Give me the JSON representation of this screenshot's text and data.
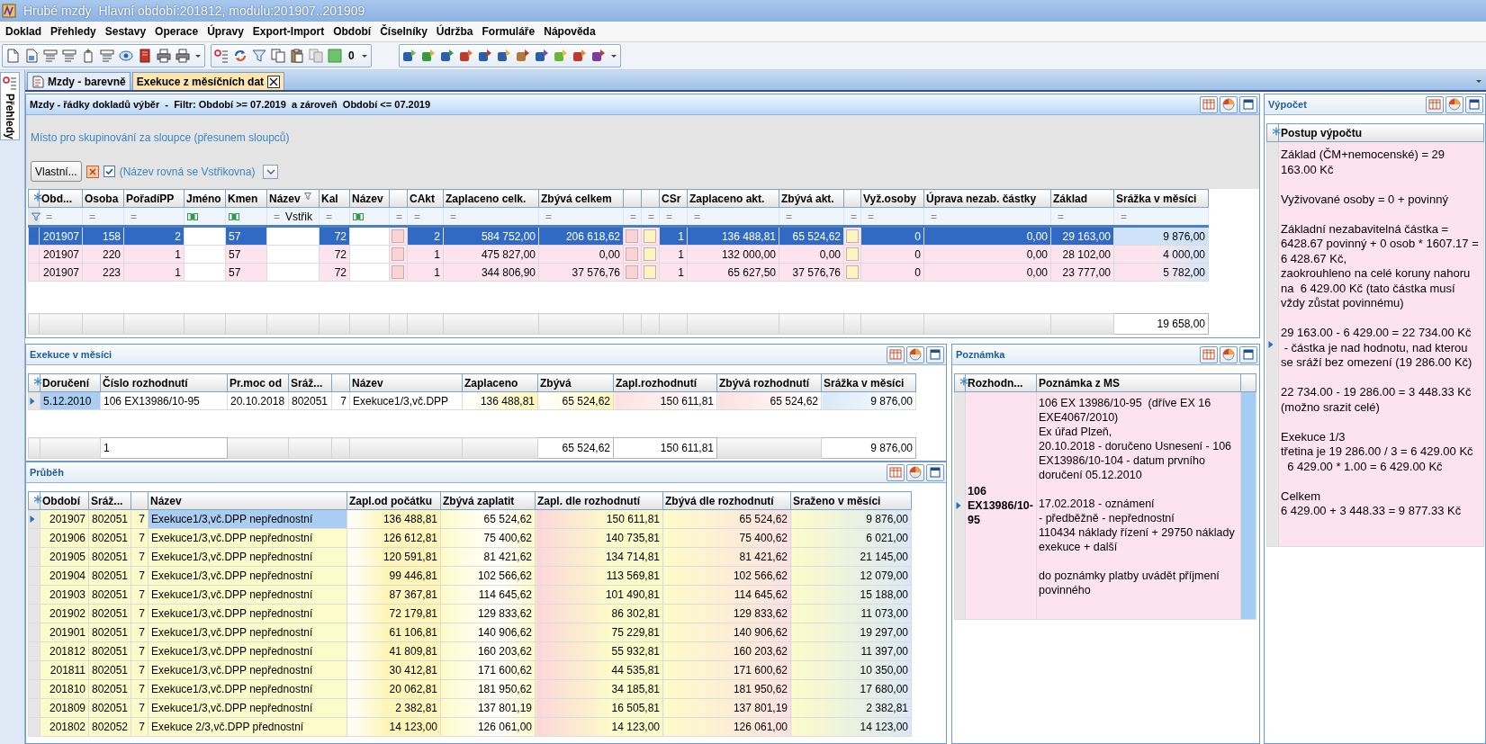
{
  "window": {
    "title": "Hrubé mzdy",
    "subtitle": "Hlavní období:201812, modulu:201907..201909"
  },
  "menu": [
    "Doklad",
    "Přehledy",
    "Sestavy",
    "Operace",
    "Úpravy",
    "Export-Import",
    "Období",
    "Číselníky",
    "Údržba",
    "Formuláře",
    "Nápověda"
  ],
  "toolbar": {
    "counter": "0"
  },
  "side_tab": {
    "label": "Přehledy"
  },
  "tabs": [
    {
      "label": "Mzdy - barevně",
      "selected": false
    },
    {
      "label": "Exekuce z měsíčních dat",
      "selected": true
    }
  ],
  "main_grid": {
    "title": "Mzdy - řádky dokladů výběr  -  Filtr: Období >= 07.2019  a zároveň  Období <= 07.2019",
    "group_hint": "Místo pro skupinování za sloupce (přesunem sloupců)",
    "filter_bar": {
      "button": "Vlastní...",
      "checked": true,
      "text": "(Název rovná se Vstřikovna)"
    },
    "columns": [
      {
        "kind": "number",
        "label": "Obd...",
        "filtered": false
      },
      {
        "kind": "number",
        "label": "Osoba",
        "filtered": false
      },
      {
        "kind": "number",
        "label": "PořadíPP",
        "filtered": false
      },
      {
        "kind": "text",
        "label": "Jméno",
        "filtered": false
      },
      {
        "kind": "text",
        "label": "Kmen",
        "filtered": false
      },
      {
        "kind": "text",
        "label": "Název",
        "filtered": true
      },
      {
        "kind": "number",
        "label": "Kal",
        "filtered": false
      },
      {
        "kind": "text",
        "label": "Název",
        "filtered": false
      },
      {
        "kind": "swatch",
        "color": "#f9d4d4"
      },
      {
        "kind": "number",
        "label": "CAkt",
        "filtered": false
      },
      {
        "kind": "number",
        "label": "Zaplaceno celk.",
        "filtered": false
      },
      {
        "kind": "number",
        "label": "Zbývá celkem",
        "filtered": false
      },
      {
        "kind": "swatch",
        "color": "#f9d4d4"
      },
      {
        "kind": "swatch",
        "color": "#fdf5bf"
      },
      {
        "kind": "number",
        "label": "CSr",
        "filtered": false
      },
      {
        "kind": "number",
        "label": "Zaplaceno akt.",
        "filtered": false
      },
      {
        "kind": "number",
        "label": "Zbývá akt.",
        "filtered": false
      },
      {
        "kind": "swatch",
        "color": "#fdf5bf"
      },
      {
        "kind": "number",
        "label": "Vyž.osoby",
        "filtered": false
      },
      {
        "kind": "number",
        "label": "Úprava nezab. částky",
        "filtered": false
      },
      {
        "kind": "number",
        "label": "Základ",
        "filtered": false
      },
      {
        "kind": "number",
        "label": "Srážka v měsíci",
        "filtered": false
      }
    ],
    "filter_row": [
      {
        "kind": "op",
        "text": "="
      },
      {
        "kind": "op",
        "text": "="
      },
      {
        "kind": "op",
        "text": "="
      },
      {
        "kind": "text_filter"
      },
      {
        "kind": "text_filter"
      },
      {
        "kind": "op",
        "text": "=",
        "value": "Vstřik"
      },
      {
        "kind": "op",
        "text": "="
      },
      {
        "kind": "text_filter"
      },
      {
        "kind": "op",
        "text": "="
      },
      {
        "kind": "op",
        "text": "="
      },
      {
        "kind": "op",
        "text": "="
      },
      {
        "kind": "op",
        "text": "="
      },
      {
        "kind": "op",
        "text": "="
      },
      {
        "kind": "op",
        "text": "="
      },
      {
        "kind": "op",
        "text": "="
      },
      {
        "kind": "op",
        "text": "="
      },
      {
        "kind": "op",
        "text": "="
      },
      {
        "kind": "op",
        "text": "="
      },
      {
        "kind": "op",
        "text": "="
      },
      {
        "kind": "op",
        "text": "="
      },
      {
        "kind": "op",
        "text": "="
      },
      {
        "kind": "op",
        "text": "="
      }
    ],
    "rows": [
      {
        "selected": true,
        "cells": [
          "201907",
          "158",
          "2",
          {
            "kind": "empty"
          },
          "57",
          {
            "kind": "empty"
          },
          "72",
          {
            "kind": "empty"
          },
          {
            "kind": "swatch"
          },
          "2",
          "584 752,00",
          "206 618,62",
          {
            "kind": "swatch"
          },
          {
            "kind": "swatch"
          },
          "1",
          "136 488,81",
          "65 524,62",
          {
            "kind": "swatch"
          },
          "0",
          "0,00",
          "29 163,00",
          {
            "text": "9 876,00",
            "focused": true
          }
        ]
      },
      {
        "selected": false,
        "cells": [
          "201907",
          "220",
          "1",
          {
            "kind": "empty"
          },
          "57",
          {
            "kind": "empty"
          },
          "72",
          {
            "kind": "empty"
          },
          {
            "kind": "swatch"
          },
          "1",
          "475 827,00",
          "0,00",
          {
            "kind": "swatch"
          },
          {
            "kind": "swatch"
          },
          "1",
          "132 000,00",
          "0,00",
          {
            "kind": "swatch"
          },
          "0",
          "0,00",
          "28 102,00",
          "4 000,00"
        ]
      },
      {
        "selected": false,
        "cells": [
          "201907",
          "223",
          "1",
          {
            "kind": "empty"
          },
          "57",
          {
            "kind": "empty"
          },
          "72",
          {
            "kind": "empty"
          },
          {
            "kind": "swatch"
          },
          "1",
          "344 806,90",
          "37 576,76",
          {
            "kind": "swatch"
          },
          {
            "kind": "swatch"
          },
          "1",
          "65 627,50",
          "37 576,76",
          {
            "kind": "swatch"
          },
          "0",
          "0,00",
          "23 777,00",
          "5 782,00"
        ]
      }
    ],
    "footer": [
      {
        "kind": "empty"
      },
      {
        "kind": "empty"
      },
      {
        "kind": "empty"
      },
      {
        "kind": "empty"
      },
      {
        "kind": "empty"
      },
      {
        "kind": "empty"
      },
      {
        "kind": "empty"
      },
      {
        "kind": "empty"
      },
      {
        "kind": "empty"
      },
      {
        "kind": "empty"
      },
      {
        "kind": "empty"
      },
      {
        "kind": "empty"
      },
      {
        "kind": "empty"
      },
      {
        "kind": "empty"
      },
      {
        "kind": "empty"
      },
      {
        "kind": "empty"
      },
      {
        "kind": "empty"
      },
      {
        "kind": "empty"
      },
      {
        "kind": "empty"
      },
      {
        "kind": "empty"
      },
      {
        "kind": "empty"
      },
      "19 658,00"
    ]
  },
  "exekuce_grid": {
    "title": "Exekuce v měsíci",
    "columns": [
      {
        "kind": "text",
        "label": "Doručení"
      },
      {
        "kind": "text",
        "label": "Číslo rozhodnutí"
      },
      {
        "kind": "text",
        "label": "Pr.moc od"
      },
      {
        "kind": "text",
        "label": "Sráž..."
      },
      {
        "kind": "number"
      },
      {
        "kind": "text",
        "label": "Název"
      },
      {
        "kind": "number",
        "label": "Zaplaceno"
      },
      {
        "kind": "number",
        "label": "Zbývá"
      },
      {
        "kind": "number",
        "label": "Zapl.rozhodnutí"
      },
      {
        "kind": "number",
        "label": "Zbývá rozhodnutí"
      },
      {
        "kind": "number",
        "label": "Srážka v měsíci"
      }
    ],
    "rows": [
      {
        "selected": true,
        "cells": [
          {
            "text": "5.12.2010",
            "focused": true
          },
          "106 EX13986/10-95",
          "20.10.2018",
          "802051",
          "7",
          "Exekuce1/3,vč.DPP",
          "136 488,81",
          "65 524,62",
          "150 611,81",
          "65 524,62",
          "9 876,00"
        ]
      }
    ],
    "footer": [
      {
        "kind": "empty"
      },
      "1",
      {
        "kind": "empty"
      },
      {
        "kind": "empty"
      },
      {
        "kind": "empty"
      },
      {
        "kind": "empty"
      },
      {
        "kind": "empty"
      },
      "65 524,62",
      "150 611,81",
      {
        "kind": "empty"
      },
      "9 876,00"
    ]
  },
  "prubeh_grid": {
    "title": "Průběh",
    "columns": [
      {
        "kind": "number",
        "label": "Období"
      },
      {
        "kind": "text",
        "label": "Sráž..."
      },
      {
        "kind": "number"
      },
      {
        "kind": "text",
        "label": "Název"
      },
      {
        "kind": "number",
        "label": "Zapl.od počátku"
      },
      {
        "kind": "number",
        "label": "Zbývá zaplatit"
      },
      {
        "kind": "number",
        "label": "Zapl. dle rozhodnutí"
      },
      {
        "kind": "number",
        "label": "Zbývá dle rozhodnutí"
      },
      {
        "kind": "number",
        "label": "Sraženo v měsíci"
      }
    ],
    "rows": [
      {
        "selected": true,
        "cells": [
          "201907",
          "802051",
          "7",
          {
            "text": "Exekuce1/3,vč.DPP nepřednostní",
            "focused": true
          },
          "136 488,81",
          "65 524,62",
          "150 611,81",
          "65 524,62",
          "9 876,00"
        ]
      },
      {
        "selected": false,
        "cells": [
          "201906",
          "802051",
          "7",
          "Exekuce1/3,vč.DPP nepřednostní",
          "126 612,81",
          "75 400,62",
          "140 735,81",
          "75 400,62",
          "6 021,00"
        ]
      },
      {
        "selected": false,
        "cells": [
          "201905",
          "802051",
          "7",
          "Exekuce1/3,vč.DPP nepřednostní",
          "120 591,81",
          "81 421,62",
          "134 714,81",
          "81 421,62",
          "21 145,00"
        ]
      },
      {
        "selected": false,
        "cells": [
          "201904",
          "802051",
          "7",
          "Exekuce1/3,vč.DPP nepřednostní",
          "99 446,81",
          "102 566,62",
          "113 569,81",
          "102 566,62",
          "12 079,00"
        ]
      },
      {
        "selected": false,
        "cells": [
          "201903",
          "802051",
          "7",
          "Exekuce1/3,vč.DPP nepřednostní",
          "87 367,81",
          "114 645,62",
          "101 490,81",
          "114 645,62",
          "15 188,00"
        ]
      },
      {
        "selected": false,
        "cells": [
          "201902",
          "802051",
          "7",
          "Exekuce1/3,vč.DPP nepřednostní",
          "72 179,81",
          "129 833,62",
          "86 302,81",
          "129 833,62",
          "11 073,00"
        ]
      },
      {
        "selected": false,
        "cells": [
          "201901",
          "802051",
          "7",
          "Exekuce1/3,vč.DPP nepřednostní",
          "61 106,81",
          "140 906,62",
          "75 229,81",
          "140 906,62",
          "19 297,00"
        ]
      },
      {
        "selected": false,
        "cells": [
          "201812",
          "802051",
          "7",
          "Exekuce1/3,vč.DPP nepřednostní",
          "41 809,81",
          "160 203,62",
          "55 932,81",
          "160 203,62",
          "11 397,00"
        ]
      },
      {
        "selected": false,
        "cells": [
          "201811",
          "802051",
          "7",
          "Exekuce1/3,vč.DPP nepřednostní",
          "30 412,81",
          "171 600,62",
          "44 535,81",
          "171 600,62",
          "10 350,00"
        ]
      },
      {
        "selected": false,
        "cells": [
          "201810",
          "802051",
          "7",
          "Exekuce1/3,vč.DPP nepřednostní",
          "20 062,81",
          "181 950,62",
          "34 185,81",
          "181 950,62",
          "17 680,00"
        ]
      },
      {
        "selected": false,
        "cells": [
          "201809",
          "802051",
          "7",
          "Exekuce1/3,vč.DPP nepřednostní",
          "2 382,81",
          "137 801,19",
          "16 505,81",
          "137 801,19",
          "2 382,81"
        ]
      },
      {
        "selected": false,
        "cells": [
          "201802",
          "802052",
          "7",
          "Exekuce 2/3,vč.DPP přednostní",
          "14 123,00",
          "126 061,00",
          "14 123,00",
          "126 061,00",
          "14 123,00"
        ]
      }
    ]
  },
  "poznamka_grid": {
    "title": "Poznámka",
    "columns": [
      {
        "kind": "text",
        "label": "Rozhodn..."
      },
      {
        "kind": "text",
        "label": "Poznámka z MS"
      },
      {
        "kind": "blank"
      }
    ],
    "rows": [
      {
        "selected": true,
        "cells": [
          "106 EX13986/10-95",
          "106 EX 13986/10-95  (dříve EX 16 EXE4067/2010)\nEx úřad Plzeň,\n20.10.2018 - doručeno Usnesení - 106 EX13986/10-104 - datum prvního doručení 05.12.2010\n\n17.02.2018 - oznámení\n- předběžně - nepřednostní\n110434 náklady řízení + 29750 náklady exekuce + další\n\ndo poznámky platby uvádět příjmení povinného",
          {
            "kind": "empty"
          }
        ]
      }
    ]
  },
  "vypocet_grid": {
    "title": "Výpočet",
    "columns": [
      {
        "kind": "text",
        "label": "Postup výpočtu"
      }
    ],
    "rows": [
      {
        "selected": true,
        "cells": [
          "Základ (ČM+nemocenské) = 29 163.00 Kč\n\nVyživované osoby = 0 + povinný\n\nZákladní nezabavitelná částka = 6428.67 povinný + 0 osob * 1607.17 = 6 428.67 Kč,\nzaokrouhleno na celé koruny nahoru na  6 429.00 Kč (tato částka musí vždy zůstat povinnému)\n\n29 163.00 - 6 429.00 = 22 734.00 Kč\n - částka je nad hodnotu, nad kterou se sráží bez omezení (19 286.00 Kč)\n\n22 734.00 - 19 286.00 = 3 448.33 Kč\n(možno srazit celé)\n\nExekuce 1/3\ntřetina je 19 286.00 / 3 = 6 429.00 Kč\n  6 429.00 * 1.00 = 6 429.00 Kč\n\nCelkem\n6 429.00 + 3 448.33 = 9 877.33 Kč"
        ]
      }
    ]
  }
}
